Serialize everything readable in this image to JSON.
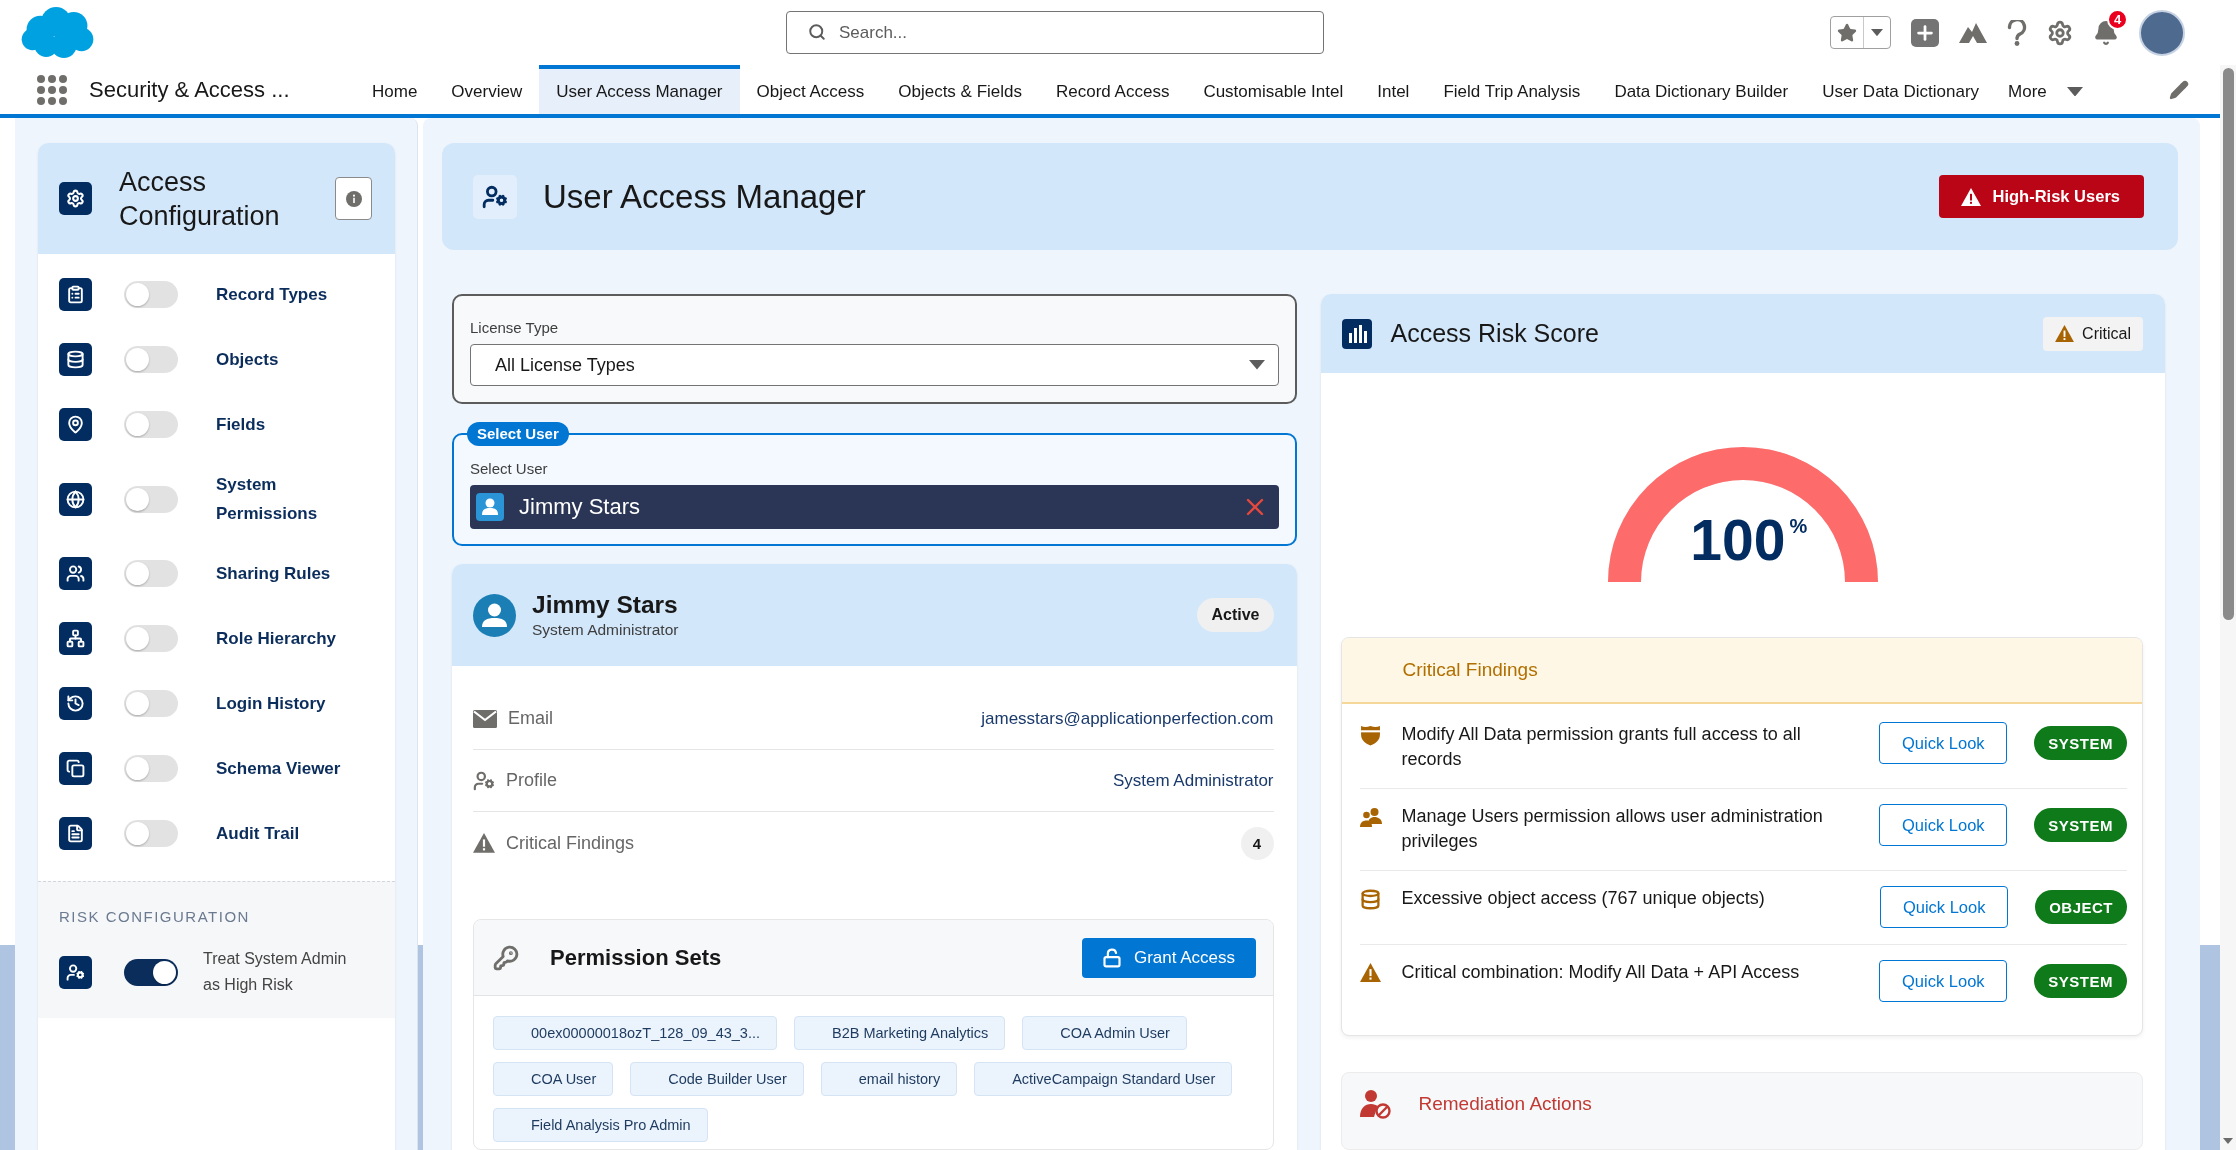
{
  "global_header": {
    "search": {
      "placeholder": "Search..."
    },
    "notification_count": "4"
  },
  "nav": {
    "app_name": "Security & Access ...",
    "tabs": [
      {
        "label": "Home",
        "selected": false
      },
      {
        "label": "Overview",
        "selected": false
      },
      {
        "label": "User Access Manager",
        "selected": true
      },
      {
        "label": "Object Access",
        "selected": false
      },
      {
        "label": "Objects & Fields",
        "selected": false
      },
      {
        "label": "Record Access",
        "selected": false
      },
      {
        "label": "Customisable Intel",
        "selected": false
      },
      {
        "label": "Intel",
        "selected": false
      },
      {
        "label": "Field Trip Analysis",
        "selected": false
      },
      {
        "label": "Data Dictionary Builder",
        "selected": false
      },
      {
        "label": "User Data Dictionary",
        "selected": false
      }
    ],
    "more": "More"
  },
  "sidebar": {
    "title": "Access Configuration",
    "items": [
      {
        "label": "Record Types",
        "on": false
      },
      {
        "label": "Objects",
        "on": false
      },
      {
        "label": "Fields",
        "on": false
      },
      {
        "label": "System Permissions",
        "on": false
      },
      {
        "label": "Sharing Rules",
        "on": false
      },
      {
        "label": "Role Hierarchy",
        "on": false
      },
      {
        "label": "Login History",
        "on": false
      },
      {
        "label": "Schema Viewer",
        "on": false
      },
      {
        "label": "Audit Trail",
        "on": false
      }
    ],
    "risk": {
      "heading": "RISK CONFIGURATION",
      "items": [
        {
          "label": "Treat System Admin as High Risk",
          "on": true
        }
      ]
    }
  },
  "page_header": {
    "title": "User Access Manager",
    "button": "High-Risk Users"
  },
  "license_filter": {
    "label": "License Type",
    "value": "All License Types"
  },
  "user_picker": {
    "badge": "Select User",
    "label": "Select User",
    "value": "Jimmy Stars"
  },
  "user_card": {
    "name": "Jimmy Stars",
    "role": "System Administrator",
    "status": "Active",
    "details": [
      {
        "kind": "text",
        "label": "Email",
        "value": "jamesstars@applicationperfection.com"
      },
      {
        "kind": "text",
        "label": "Profile",
        "value": "System Administrator"
      },
      {
        "kind": "count",
        "label": "Critical Findings",
        "value": "4"
      }
    ]
  },
  "permission_sets": {
    "title": "Permission Sets",
    "button": "Grant Access",
    "items": [
      "00ex00000018ozT_128_09_43_3...",
      "B2B Marketing Analytics",
      "COA Admin User",
      "COA User",
      "Code Builder User",
      "email history",
      "ActiveCampaign Standard User",
      "Field Analysis Pro Admin"
    ]
  },
  "risk_score": {
    "title": "Access Risk Score",
    "badge": "Critical",
    "gauge": {
      "value": "100",
      "unit": "%",
      "level": 1
    }
  },
  "critical_findings": {
    "title": "Critical Findings",
    "items": [
      {
        "text": "Modify All Data permission grants full access to all records",
        "button": "Quick Look",
        "category": "SYSTEM"
      },
      {
        "text": "Manage Users permission allows user administration privileges",
        "button": "Quick Look",
        "category": "SYSTEM"
      },
      {
        "text": "Excessive object access (767 unique objects)",
        "button": "Quick Look",
        "category": "OBJECT"
      },
      {
        "text": "Critical combination: Modify All Data + API Access",
        "button": "Quick Look",
        "category": "SYSTEM"
      }
    ]
  },
  "remediation": {
    "title": "Remediation Actions"
  }
}
